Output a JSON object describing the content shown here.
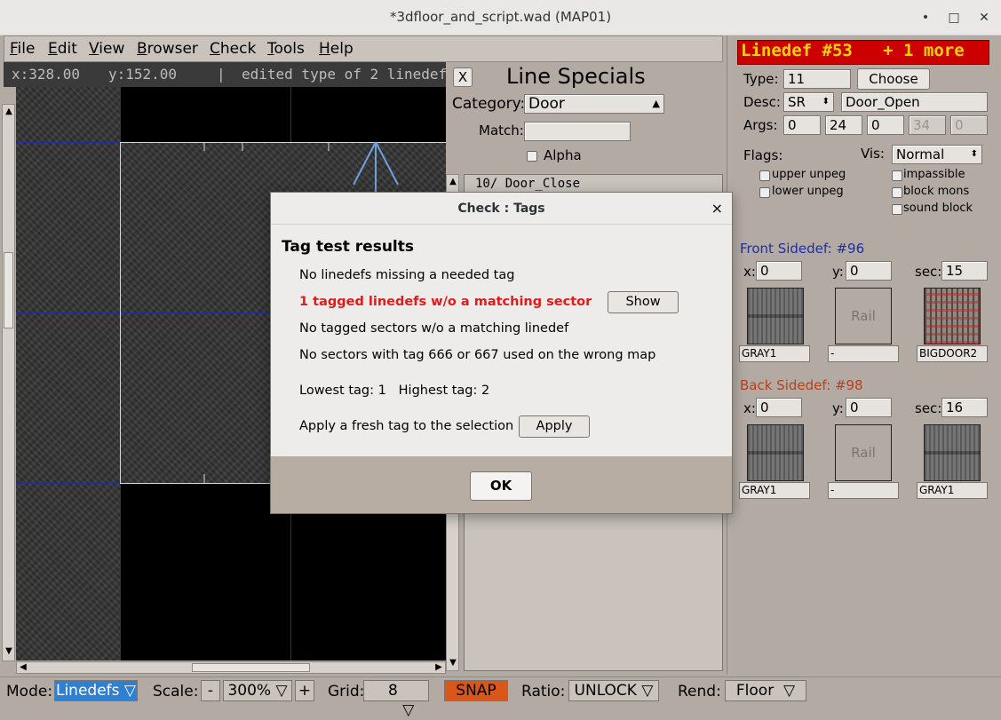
{
  "window": {
    "title": "*3dfloor_and_script.wad (MAP01)",
    "min": "•",
    "max": "□",
    "close": "✕"
  },
  "menu": [
    {
      "label": "File",
      "u": "F",
      "rest": "ile"
    },
    {
      "label": "Edit",
      "u": "E",
      "rest": "dit"
    },
    {
      "label": "View",
      "u": "V",
      "rest": "iew"
    },
    {
      "label": "Browser",
      "u": "B",
      "rest": "rowser"
    },
    {
      "label": "Check",
      "u": "C",
      "rest": "heck"
    },
    {
      "label": "Tools",
      "u": "T",
      "rest": "ools"
    },
    {
      "label": "Help",
      "u": "H",
      "rest": "elp"
    }
  ],
  "coords": {
    "x": "x:328.00",
    "y": "y:152.00",
    "sep": "|",
    "status": "edited type of 2 linedefs"
  },
  "specials": {
    "close": "X",
    "title": "Line Specials",
    "category_label": "Category:",
    "category_value": "Door",
    "match_label": "Match:",
    "match_value": "",
    "alpha_label": "Alpha",
    "list_first": "10/ Door_Close"
  },
  "linedef": {
    "header": "Linedef #53",
    "more": "+ 1 more",
    "header_color": "#cc0000",
    "header_text_color": "#ffd400",
    "type_label": "Type:",
    "type_value": "11",
    "choose_label": "Choose",
    "desc_label": "Desc:",
    "desc_trigger": "SR",
    "desc_value": "Door_Open",
    "args_label": "Args:",
    "args": [
      "0",
      "24",
      "0",
      "34",
      "0"
    ],
    "flags_label": "Flags:",
    "vis_label": "Vis:",
    "vis_value": "Normal",
    "flags_left": [
      "upper unpeg",
      "lower unpeg"
    ],
    "flags_right": [
      "impassible",
      "block mons",
      "sound block"
    ]
  },
  "front": {
    "title": "Front Sidedef: #96",
    "x_label": "x:",
    "x": "0",
    "y_label": "y:",
    "y": "0",
    "sec_label": "sec:",
    "sec": "15",
    "rail": "Rail",
    "tex_lower": "GRAY1",
    "tex_mid": "-",
    "tex_upper": "BIGDOOR2"
  },
  "back": {
    "title": "Back Sidedef: #98",
    "x_label": "x:",
    "x": "0",
    "y_label": "y:",
    "y": "0",
    "sec_label": "sec:",
    "sec": "16",
    "rail": "Rail",
    "tex_lower": "GRAY1",
    "tex_mid": "-",
    "tex_upper": "GRAY1"
  },
  "bottom": {
    "mode_label": "Mode:",
    "mode_value": "Linedefs",
    "scale_label": "Scale:",
    "scale_minus": "-",
    "scale_value": "300%",
    "scale_plus": "+",
    "grid_label": "Grid:",
    "grid_value": "8",
    "snap": "SNAP",
    "ratio_label": "Ratio:",
    "ratio_value": "UNLOCK",
    "rend_label": "Rend:",
    "rend_value": "Floor",
    "mode_color": "#2f7fd3",
    "snap_color": "#d9571a"
  },
  "dialog": {
    "title": "Check : Tags",
    "close": "×",
    "heading": "Tag test results",
    "line1": "No linedefs missing a needed tag",
    "line2": "1 tagged linedefs w/o a matching sector",
    "line2_color": "#e01b1b",
    "show": "Show",
    "line3": "No tagged sectors w/o a matching linedef",
    "line4": "No sectors with tag 666 or 667 used on the wrong map",
    "tags": "Lowest tag: 1   Highest tag: 2",
    "apply_text": "Apply a fresh tag to the selection",
    "apply": "Apply",
    "ok": "OK"
  }
}
